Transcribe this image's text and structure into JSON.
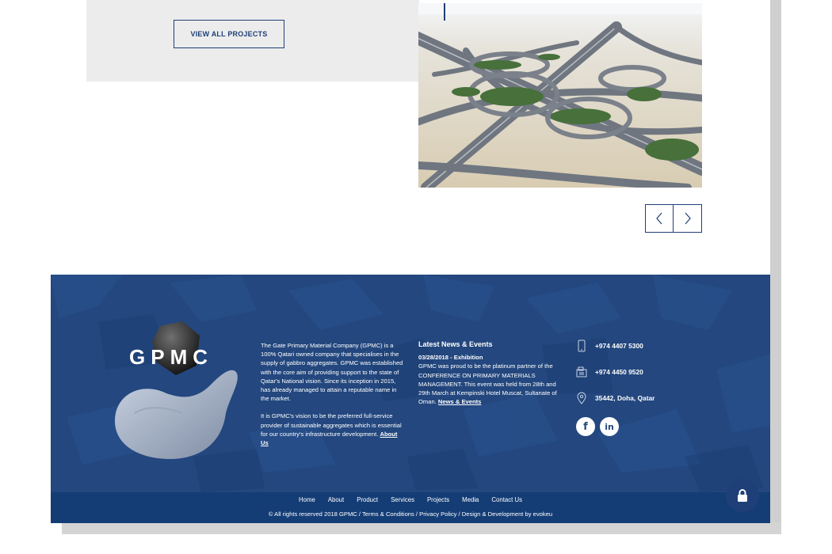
{
  "projects": {
    "view_all_label": "VIEW ALL PROJECTS"
  },
  "footer": {
    "logo_text": "GPMC",
    "about": {
      "paragraph1": "The Gate Primary Material Company (GPMC) is a 100% Qatari owned company that specialises in the supply of gabbro aggregates. GPMC was established with the core aim of providing support to the state of Qatar's National vision. Since its inception in 2015, has already managed to attain a reputable name in the market.",
      "paragraph2": "It is GPMC's vision to be the preferred full-service provider of sustainable aggregates which is essential for our country's infrastructure development.",
      "link": "About Us"
    },
    "news": {
      "title": "Latest News & Events",
      "date": "03/28/2018 - Exhibition",
      "body": "GPMC was proud to be the platinum partner of the CONFERENCE ON PRIMARY MATERIALS MANAGEMENT. This event was held from 28th and 29th March at Kempinski Hotel Muscat, Sultanate of Oman.",
      "link": "News & Events"
    },
    "contact": {
      "phone": "+974 4407 5300",
      "fax": "+974 4450 9520",
      "address": "35442, Doha, Qatar"
    },
    "socials": {
      "facebook": "f",
      "linkedin": "in"
    },
    "menu": [
      "Home",
      "About",
      "Product",
      "Services",
      "Projects",
      "Media",
      "Contact Us"
    ],
    "copyright": "© All rights reserved 2018 GPMC / Terms & Conditions / Privacy Policy / Design & Development by evokeu"
  },
  "colors": {
    "brand_blue": "#23477e",
    "bar_blue": "#143d76",
    "panel_grey": "#ececec"
  },
  "icons": [
    "chevron-left-icon",
    "chevron-right-icon",
    "mobile-phone-icon",
    "fax-icon",
    "location-pin-icon",
    "facebook-icon",
    "linkedin-icon",
    "lock-icon"
  ]
}
